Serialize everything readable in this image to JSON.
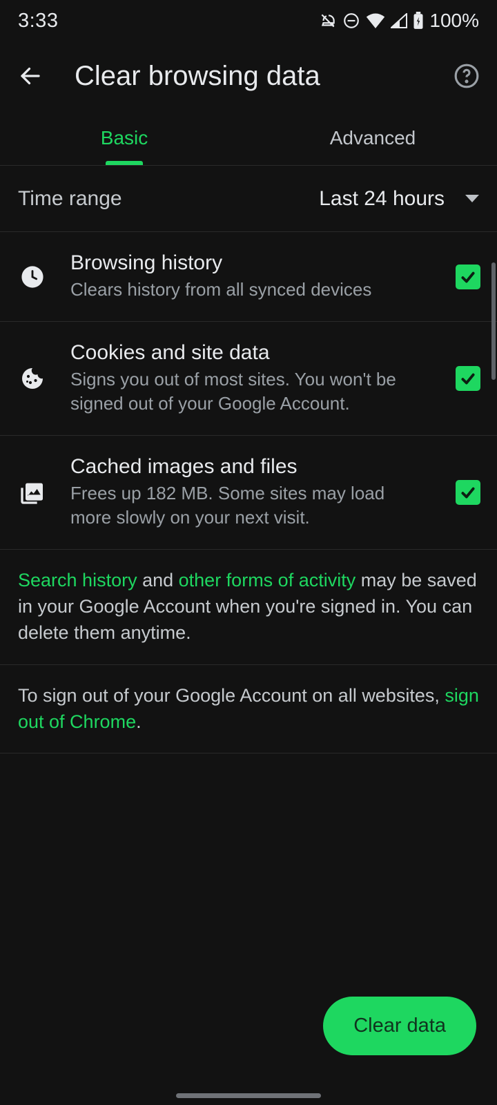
{
  "status": {
    "time": "3:33",
    "battery": "100%"
  },
  "header": {
    "title": "Clear browsing data"
  },
  "tabs": {
    "basic": "Basic",
    "advanced": "Advanced"
  },
  "timeRange": {
    "label": "Time range",
    "value": "Last 24 hours"
  },
  "options": {
    "history": {
      "title": "Browsing history",
      "desc": "Clears history from all synced devices"
    },
    "cookies": {
      "title": "Cookies and site data",
      "desc": "Signs you out of most sites. You won't be signed out of your Google Account."
    },
    "cache": {
      "title": "Cached images and files",
      "desc": "Frees up 182 MB. Some sites may load more slowly on your next visit."
    }
  },
  "info1": {
    "link1": "Search history",
    "mid1": " and ",
    "link2": "other forms of activity",
    "rest": " may be saved in your Google Account when you're signed in. You can delete them anytime."
  },
  "info2": {
    "pre": "To sign out of your Google Account on all websites, ",
    "link": "sign out of Chrome",
    "post": "."
  },
  "fab": "Clear data"
}
